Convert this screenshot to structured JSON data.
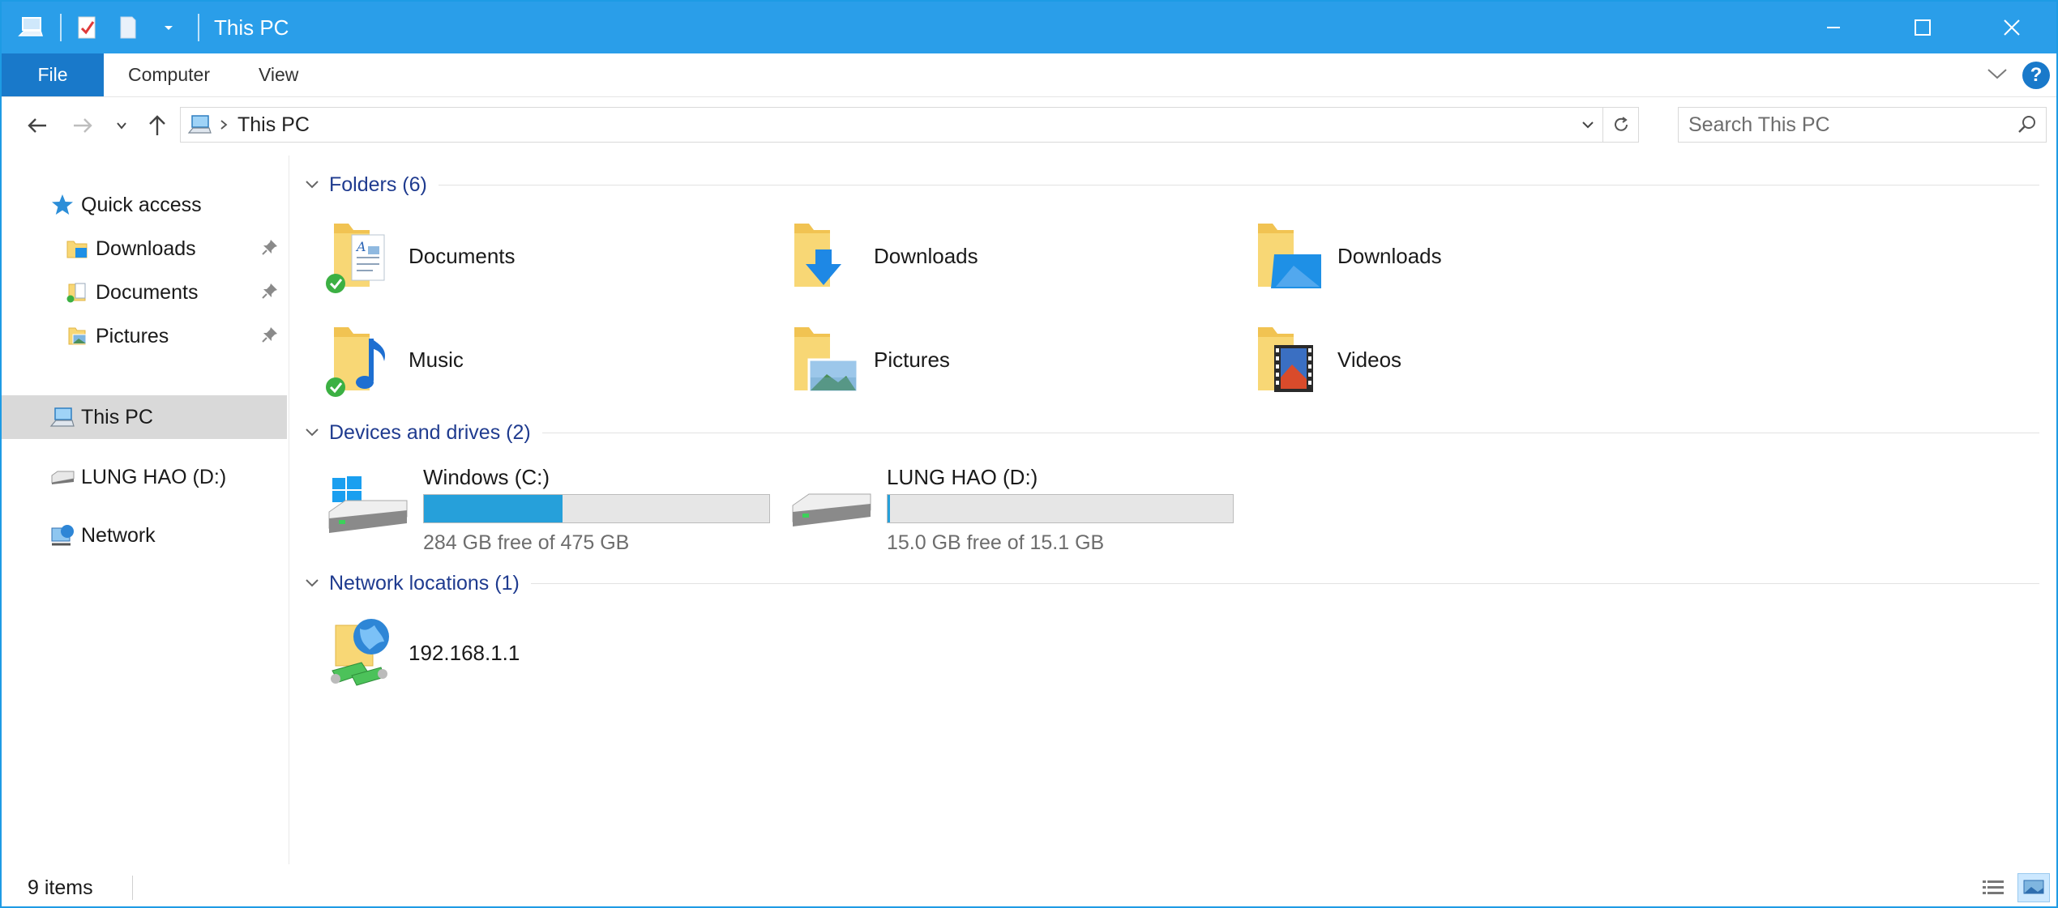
{
  "window": {
    "title": "This PC",
    "colors": {
      "titlebar": "#2a9ee9",
      "file_tab": "#1979ca",
      "accent": "#26a0da",
      "group_header": "#1f3b8f"
    }
  },
  "ribbon": {
    "tabs": [
      {
        "label": "File"
      },
      {
        "label": "Computer"
      },
      {
        "label": "View"
      }
    ]
  },
  "address": {
    "path": [
      "This PC"
    ],
    "search_placeholder": "Search This PC"
  },
  "nav": {
    "quick_access": "Quick access",
    "quick_items": [
      {
        "label": "Downloads",
        "icon": "downloads-folder-icon",
        "pinned": true
      },
      {
        "label": "Documents",
        "icon": "documents-folder-icon",
        "pinned": true
      },
      {
        "label": "Pictures",
        "icon": "pictures-folder-icon",
        "pinned": true
      }
    ],
    "this_pc": "This PC",
    "drive": "LUNG HAO (D:)",
    "network": "Network"
  },
  "groups": {
    "folders": "Folders (6)",
    "devices": "Devices and drives (2)",
    "network": "Network locations (1)"
  },
  "folders": [
    {
      "label": "Documents",
      "icon": "documents-folder-icon"
    },
    {
      "label": "Downloads",
      "icon": "downloads-folder-icon"
    },
    {
      "label": "Downloads",
      "icon": "desktop-folder-icon"
    },
    {
      "label": "Music",
      "icon": "music-folder-icon"
    },
    {
      "label": "Pictures",
      "icon": "pictures-folder-icon"
    },
    {
      "label": "Videos",
      "icon": "videos-folder-icon"
    }
  ],
  "drives": [
    {
      "name": "Windows (C:)",
      "free_text": "284 GB free of 475 GB",
      "used_fraction": 0.402
    },
    {
      "name": "LUNG HAO (D:)",
      "free_text": "15.0 GB free of 15.1 GB",
      "used_fraction": 0.007
    }
  ],
  "network_locations": [
    {
      "label": "192.168.1.1"
    }
  ],
  "status": {
    "items": "9 items"
  }
}
